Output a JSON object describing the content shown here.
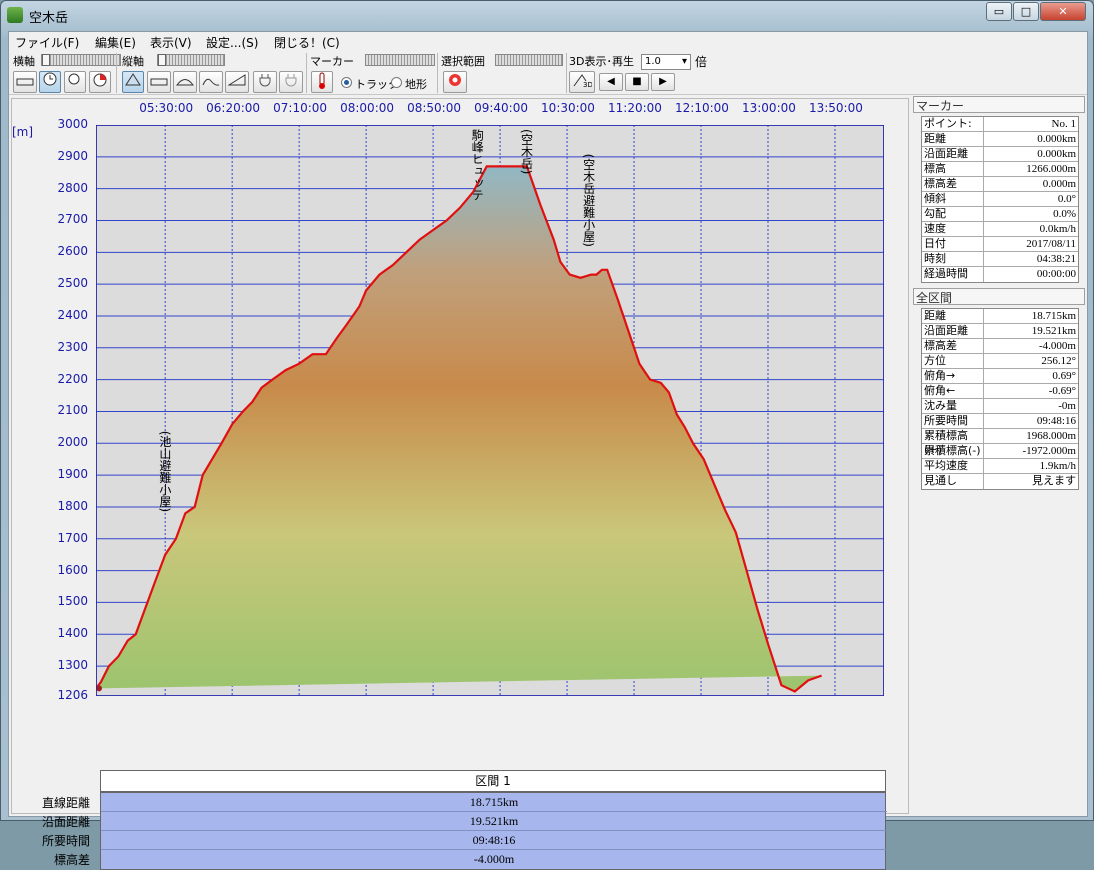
{
  "window": {
    "title": "空木岳",
    "buttons": {
      "minimize": "▭",
      "maximize": "□",
      "close": "✕"
    }
  },
  "menu": [
    "ファイル(F)",
    "編集(E)",
    "表示(V)",
    "設定...(S)",
    "閉じる！(C)"
  ],
  "toolbar": {
    "horizontal_axis": "横軸",
    "vertical_axis": "縦軸",
    "marker": "マーカー",
    "selection": "選択範囲",
    "play3d": "3D表示･再生",
    "speed": "1.0",
    "speed_unit": "倍",
    "radio_track": "トラック",
    "radio_terrain": "地形"
  },
  "chart_data": {
    "type": "area",
    "ylabel": "[m]",
    "ylim": [
      1206,
      3000
    ],
    "yticks": [
      "3000",
      "2900",
      "2800",
      "2700",
      "2600",
      "2500",
      "2400",
      "2300",
      "2200",
      "2100",
      "2000",
      "1900",
      "1800",
      "1700",
      "1600",
      "1500",
      "1400",
      "1300",
      "1206"
    ],
    "xticks": [
      "05:30:00",
      "06:20:00",
      "07:10:00",
      "08:00:00",
      "08:50:00",
      "09:40:00",
      "10:30:00",
      "11:20:00",
      "12:10:00",
      "13:00:00",
      "13:50:00"
    ],
    "x_range_minutes": [
      278.35,
      866.6
    ],
    "series": [
      {
        "x_minutes": [
          278.35,
          282,
          288,
          295,
          302,
          308,
          315,
          322,
          330,
          338,
          345,
          352,
          358,
          365,
          372,
          380,
          388,
          395,
          402,
          410,
          420,
          430,
          440,
          450,
          458,
          465,
          470,
          475,
          480,
          490,
          500,
          510,
          520,
          530,
          540,
          550,
          560,
          570,
          580,
          590,
          600,
          610,
          620,
          625,
          632,
          640,
          648,
          652,
          656,
          660,
          668,
          676,
          684,
          692,
          700,
          706,
          712,
          718,
          724,
          732,
          740,
          748,
          756,
          764,
          772,
          780,
          790,
          800,
          810,
          820,
          830,
          840,
          850,
          855,
          860,
          866.6
        ],
        "elevation": [
          1230,
          1250,
          1300,
          1330,
          1380,
          1400,
          1480,
          1560,
          1650,
          1700,
          1780,
          1800,
          1900,
          1950,
          2000,
          2060,
          2100,
          2130,
          2175,
          2200,
          2230,
          2250,
          2280,
          2280,
          2330,
          2370,
          2400,
          2430,
          2480,
          2530,
          2560,
          2600,
          2640,
          2670,
          2700,
          2740,
          2790,
          2870,
          2870,
          2870,
          2870,
          2750,
          2640,
          2570,
          2530,
          2520,
          2530,
          2530,
          2545,
          2545,
          2450,
          2350,
          2250,
          2200,
          2190,
          2160,
          2090,
          2050,
          2000,
          1950,
          1870,
          1790,
          1720,
          1600,
          1480,
          1370,
          1240,
          1220,
          1255,
          1270
        ]
      }
    ],
    "annotations": [
      {
        "label": "(池山避難小屋)",
        "x_minutes": 329.8,
        "elevation": 1700
      },
      {
        "label": "駒峰ヒュッテ",
        "x_minutes": 563.0,
        "elevation": 2870
      },
      {
        "label": "(空木岳)",
        "x_minutes": 599.7,
        "elevation": 2870
      },
      {
        "label": "(空木岳避難小屋)",
        "x_minutes": 646.1,
        "elevation": 2530
      }
    ]
  },
  "marker_panel": {
    "title": "マーカー",
    "rows": [
      [
        "ポイント:",
        "No. 1"
      ],
      [
        "距離",
        "0.000km"
      ],
      [
        "沿面距離",
        "0.000km"
      ],
      [
        "標高",
        "1266.000m"
      ],
      [
        "標高差",
        "0.000m"
      ],
      [
        "傾斜",
        "0.0°"
      ],
      [
        "勾配",
        "0.0%"
      ],
      [
        "速度",
        "0.0km/h"
      ],
      [
        "日付",
        "2017/08/11"
      ],
      [
        "時刻",
        "04:38:21"
      ],
      [
        "経過時間",
        "00:00:00"
      ]
    ]
  },
  "total_panel": {
    "title": "全区間",
    "rows": [
      [
        "距離",
        "18.715km"
      ],
      [
        "沿面距離",
        "19.521km"
      ],
      [
        "標高差",
        "-4.000m"
      ],
      [
        "方位",
        "256.12°"
      ],
      [
        "俯角→",
        "0.69°"
      ],
      [
        "俯角←",
        "-0.69°"
      ],
      [
        "沈み量",
        "-0m"
      ],
      [
        "所要時間",
        "09:48:16"
      ],
      [
        "累積標高(+)",
        "1968.000m"
      ],
      [
        "累積標高(-)",
        "-1972.000m"
      ],
      [
        "平均速度",
        "1.9km/h"
      ],
      [
        "見通し",
        "見えます"
      ]
    ]
  },
  "section": {
    "title": "区間 1",
    "rows": [
      [
        "直線距離",
        "18.715km"
      ],
      [
        "沿面距離",
        "19.521km"
      ],
      [
        "所要時間",
        "09:48:16"
      ],
      [
        "標高差",
        "-4.000m"
      ]
    ]
  }
}
